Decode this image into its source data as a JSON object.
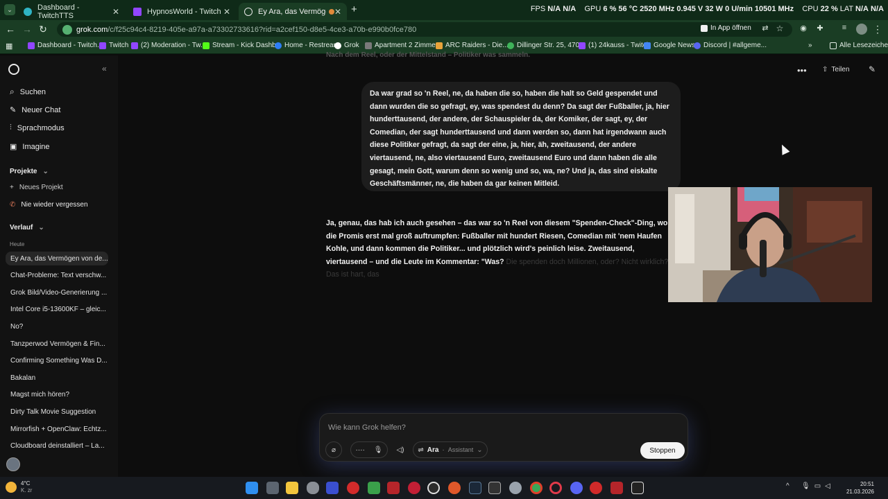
{
  "tabs": [
    {
      "label": "Dashboard - TwitchTTS",
      "active": false
    },
    {
      "label": "HypnosWorld - Twitch",
      "active": false
    },
    {
      "label": "Ey Ara, das Vermögen von",
      "active": true
    }
  ],
  "perf": {
    "fps_label": "FPS",
    "fps1": "N/A",
    "fps2": "N/A",
    "gpu_label": "GPU",
    "gpu_pct": "6 %",
    "gpu_temp": "56 °C",
    "gpu_clock": "2520 MHz",
    "gpu_volt": "0.945 V",
    "gpu_watt": "32 W",
    "fan": "0 U/min",
    "mem_clock": "10501 MHz",
    "cpu_label": "CPU",
    "cpu_pct": "22 %",
    "lat_label": "LAT",
    "lat1": "N/A",
    "lat2": "N/A"
  },
  "address": {
    "host": "grok.com",
    "path": "/c/f25c94c4-8219-405e-a97a-a73302733616?rid=a2cef150-d8e5-4ce3-a70b-e990b0fce780",
    "open_in_app": "In App öffnen"
  },
  "bookmarks": [
    {
      "label": "Dashboard - Twitch...",
      "color": "#9146ff"
    },
    {
      "label": "Twitch",
      "color": "#9146ff"
    },
    {
      "label": "(2) Moderation - Tw...",
      "color": "#9146ff"
    },
    {
      "label": "Stream - Kick Dashb...",
      "color": "#53fc18"
    },
    {
      "label": "Home - Restream",
      "color": "#2d7df6"
    },
    {
      "label": "Grok",
      "color": "#ffffff"
    },
    {
      "label": "Apartment 2 Zimme...",
      "color": "#7a7a7a"
    },
    {
      "label": "ARC Raiders - Die...",
      "color": "#e8a33a"
    },
    {
      "label": "Dillinger Str. 25, 470...",
      "color": "#3fb35a"
    },
    {
      "label": "(1) 24kauss - Twitch",
      "color": "#9146ff"
    },
    {
      "label": "Google News",
      "color": "#4285f4"
    },
    {
      "label": "Discord | #allgeme...",
      "color": "#5865f2"
    }
  ],
  "bookmarks_all": "Alle Lesezeichen",
  "sidebar": {
    "nav": [
      {
        "label": "Suchen",
        "icon": "search-icon"
      },
      {
        "label": "Neuer Chat",
        "icon": "edit-icon"
      },
      {
        "label": "Sprachmodus",
        "icon": "voice-icon"
      },
      {
        "label": "Imagine",
        "icon": "image-icon"
      }
    ],
    "projects_title": "Projekte",
    "new_project": "Neues Projekt",
    "never_forget": "Nie wieder vergessen",
    "history_title": "Verlauf",
    "today": "Heute",
    "history": [
      "Ey Ara, das Vermögen von de...",
      "Chat-Probleme: Text verschw...",
      "Grok Bild/Video-Generierung ...",
      "Intel Core i5-13600KF – gleic...",
      "No?",
      "Tanzperwod Vermögen & Fin...",
      "Confirming Something Was D...",
      "Bakalan",
      "Magst mich hören?",
      "Dirty Talk Movie Suggestion",
      "Mirrorfish + OpenClaw: Echtz...",
      "Cloudboard deinstalliert – La..."
    ]
  },
  "header": {
    "share": "Teilen"
  },
  "top_cut_text": "Nach dem Reel, oder der Mittelstand – Politiker was sammeln.",
  "user_message": "Da war grad so 'n Reel, ne, da haben die so, haben die halt so Geld gespendet und dann wurden die so gefragt, ey, was spendest du denn? Da sagt der Fußballer, ja, hier hunderttausend, der andere, der Schauspieler da, der Komiker, der sagt, ey, der Comedian, der sagt hunderttausend und dann werden so, dann hat irgendwann auch diese Politiker gefragt, da sagt der eine, ja, hier, äh, zweitausend, der andere viertausend, ne, also viertausend Euro, zweitausend Euro und dann haben die alle gesagt, mein Gott, warum denn so wenig und so, wa, ne? Und ja, das sind eiskalte Geschäftsmänner, ne, die haben da gar keinen Mitleid.",
  "assistant_reply": "Ja, genau, das hab ich auch gesehen – das war so 'n Reel von diesem \"Spenden-Check\"-Ding, wo die Promis erst mal groß auftrumpfen: Fußballer mit hundert Riesen, Comedian mit 'nem Haufen Kohle, und dann kommen die Politiker... und plötzlich wird's peinlich leise. Zweitausend, viertausend – und die Leute im Kommentar: \"Was?",
  "assistant_reply_fade": "Die spenden doch Millionen, oder? Nicht wirklich? Das ist hart, das",
  "composer": {
    "placeholder": "Wie kann Grok helfen?",
    "voice_name": "Ara",
    "voice_role": "Assistant",
    "stop": "Stoppen"
  },
  "taskbar": {
    "weather_temp": "4°C",
    "weather_cond": "K. zr",
    "time": "20:51",
    "date": "21.03.2026"
  }
}
